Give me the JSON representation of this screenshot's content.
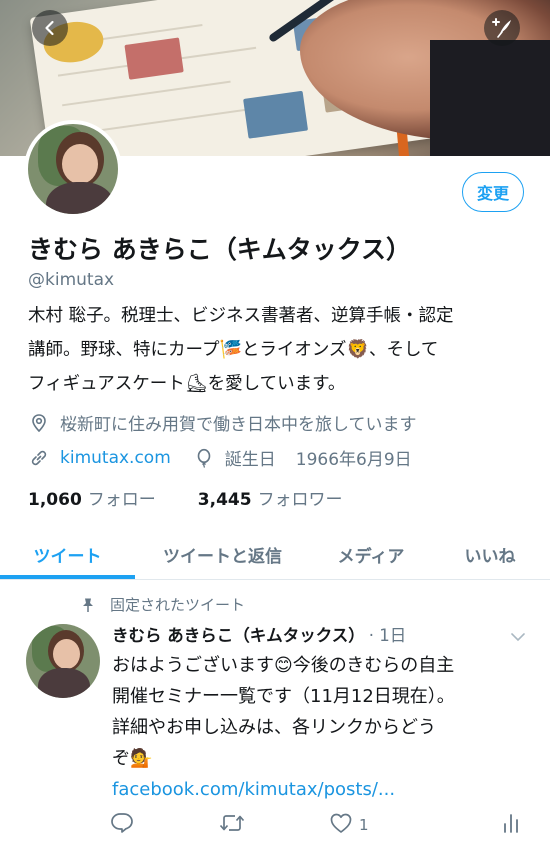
{
  "header": {
    "back_icon": "chevron-left-icon",
    "compose_icon": "quill-plus-icon"
  },
  "profile": {
    "edit_label": "変更",
    "display_name": "きむら あきらこ（キムタックス）",
    "handle": "@kimutax",
    "bio_line1": "木村 聡子。税理士、ビジネス書著者、逆算手帳・認定",
    "bio_line2_a": "講師。野球、特にカープ",
    "bio_line2_b": "とライオンズ",
    "bio_line2_c": "、そして",
    "bio_line3_a": "フィギュアスケート",
    "bio_line3_b": "を愛しています。",
    "emoji_carp": "🎏",
    "emoji_lion": "🦁",
    "emoji_skate": "⛸",
    "location": "桜新町に住み用賀で働き日本中を旅しています",
    "website": "kimutax.com",
    "birthday_label": "誕生日",
    "birthday": "1966年6月9日",
    "following_count": "1,060",
    "following_label": "フォロー",
    "followers_count": "3,445",
    "followers_label": "フォロワー"
  },
  "tabs": [
    {
      "label": "ツイート",
      "active": true
    },
    {
      "label": "ツイートと返信",
      "active": false
    },
    {
      "label": "メディア",
      "active": false
    },
    {
      "label": "いいね",
      "active": false
    }
  ],
  "tweet": {
    "pinned_label": "固定されたツイート",
    "author": "きむら あきらこ（キムタックス）",
    "time": "· 1日",
    "text_line1_a": "おはようございます",
    "emoji_smile": "😊",
    "text_line1_b": "今後のきむらの自主",
    "text_line2": "開催セミナー一覧です（11月12日現在）。",
    "text_line3": "詳細やお申し込みは、各リンクからどう",
    "text_line4": "ぞ",
    "emoji_person": "💁",
    "link": "facebook.com/kimutax/posts/...",
    "like_count": "1"
  },
  "colors": {
    "accent": "#1da1f2",
    "link": "#1b95e0",
    "muted": "#657786",
    "text": "#14171a"
  }
}
